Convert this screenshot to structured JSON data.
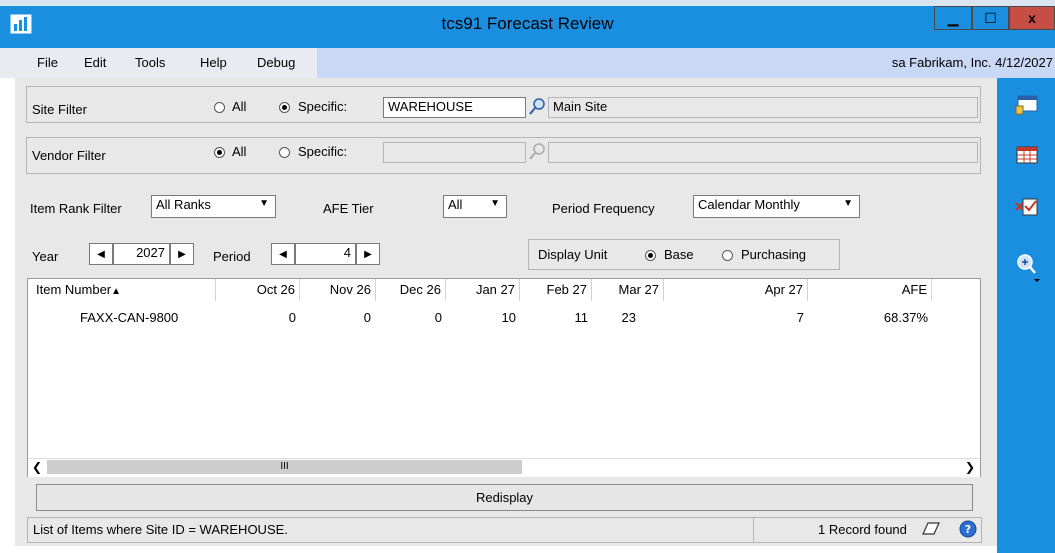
{
  "window": {
    "title": "tcs91 Forecast Review",
    "min_glyph": "▁",
    "max_glyph": "☐",
    "close_glyph": "x"
  },
  "menu": {
    "items": [
      "File",
      "Edit",
      "Tools",
      "Help",
      "Debug"
    ],
    "user_info": "sa  Fabrikam, Inc.  4/12/2027"
  },
  "site_filter": {
    "label": "Site Filter",
    "all_label": "All",
    "specific_label": "Specific:",
    "selected": "Specific",
    "value": "WAREHOUSE",
    "description": "Main Site"
  },
  "vendor_filter": {
    "label": "Vendor Filter",
    "all_label": "All",
    "specific_label": "Specific:",
    "selected": "All",
    "value": "",
    "description": ""
  },
  "item_rank_filter": {
    "label": "Item Rank Filter",
    "value": "All Ranks"
  },
  "afe_tier": {
    "label": "AFE Tier",
    "value": "All"
  },
  "period_frequency": {
    "label": "Period Frequency",
    "value": "Calendar Monthly"
  },
  "year": {
    "label": "Year",
    "value": "2027"
  },
  "period": {
    "label": "Period",
    "value": "4"
  },
  "display_unit": {
    "label": "Display Unit",
    "base_label": "Base",
    "purchasing_label": "Purchasing",
    "selected": "Base"
  },
  "grid": {
    "columns": [
      "Item Number",
      "Oct 26",
      "Nov 26",
      "Dec 26",
      "Jan 27",
      "Feb 27",
      "Mar 27",
      "Apr 27",
      "AFE"
    ],
    "rows": [
      {
        "item_number": "FAXX-CAN-9800",
        "oct26": "0",
        "nov26": "0",
        "dec26": "0",
        "jan27": "10",
        "feb27": "11",
        "mar27": "23",
        "apr27": "7",
        "afe": "68.37%"
      }
    ],
    "scroll_thumb_glyph": "III"
  },
  "redisplay_label": "Redisplay",
  "status": {
    "message": "List of Items where Site ID = WAREHOUSE.",
    "record_count": "1 Record found"
  },
  "colors": {
    "title_bar": "#1a8fe0",
    "menu_bar": "#c9d9f5",
    "panel": "#e8e8e8",
    "close": "#c74e44"
  }
}
